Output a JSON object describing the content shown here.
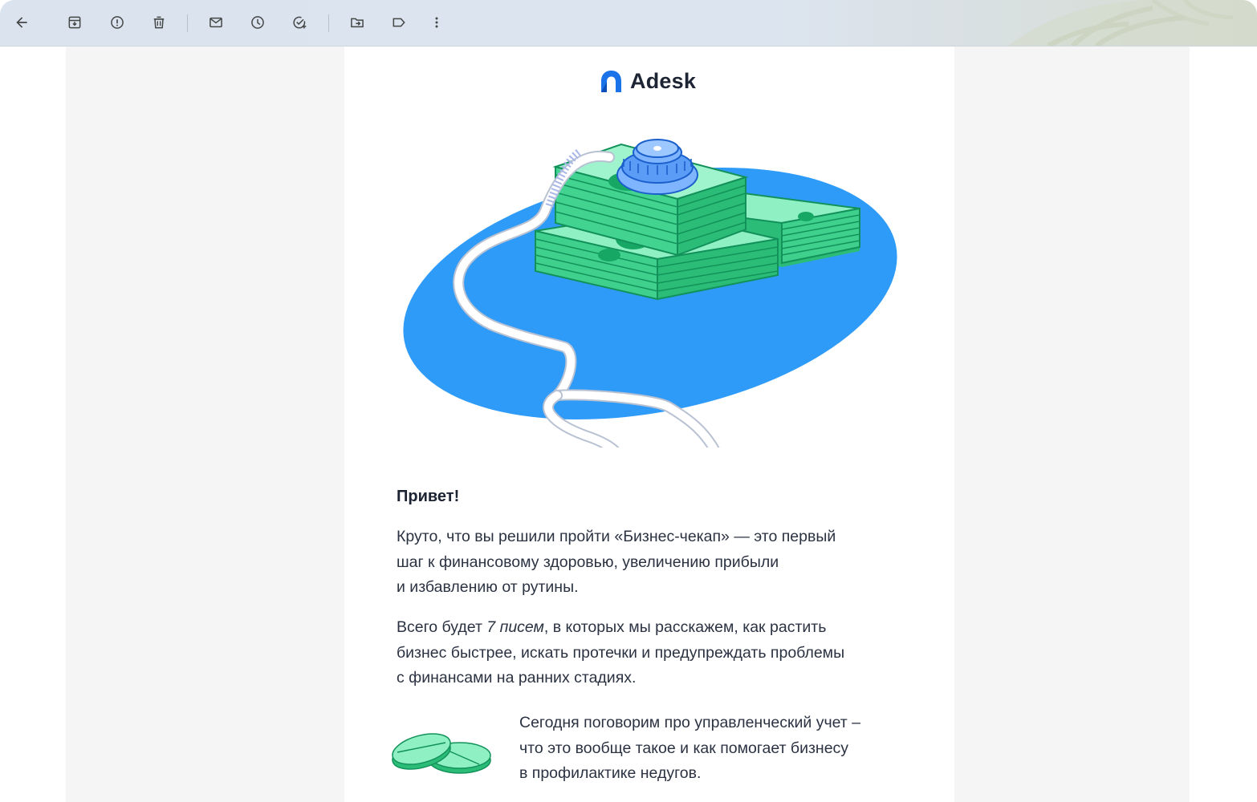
{
  "toolbar": {
    "icons": [
      "back-arrow-icon",
      "archive-icon",
      "report-spam-icon",
      "delete-icon",
      "mark-unread-icon",
      "snooze-icon",
      "add-task-icon",
      "move-to-icon",
      "label-icon",
      "more-vert-icon"
    ]
  },
  "email": {
    "brand": "Adesk",
    "greeting": "Привет!",
    "paragraph1": {
      "line1": "Круто, что вы решили пройти «Бизнес-чекап» — это первый",
      "line2": "шаг к финансовому здоровью, увеличению прибыли",
      "line3": "и избавлению от рутины."
    },
    "paragraph2": {
      "before": "Всего будет ",
      "emphasis": "7 писем",
      "after": ", в которых мы расскажем, как растить",
      "line2": "бизнес быстрее, искать протечки и предупреждать проблемы",
      "line3": "с финансами на ранних стадиях."
    },
    "paragraph3": {
      "line1": "Сегодня поговорим про управленческий учет –",
      "line2": "что это вообще такое и как помогает бизнесу",
      "line3": "в профилактике недугов."
    }
  },
  "colors": {
    "brand_blue": "#1a73e8",
    "ellipse_blue": "#2f9bf8",
    "money_green": "#5fe0a3",
    "money_dark": "#2bbd77",
    "text": "#2b3242",
    "viewer_bg": "#f5f5f5"
  }
}
